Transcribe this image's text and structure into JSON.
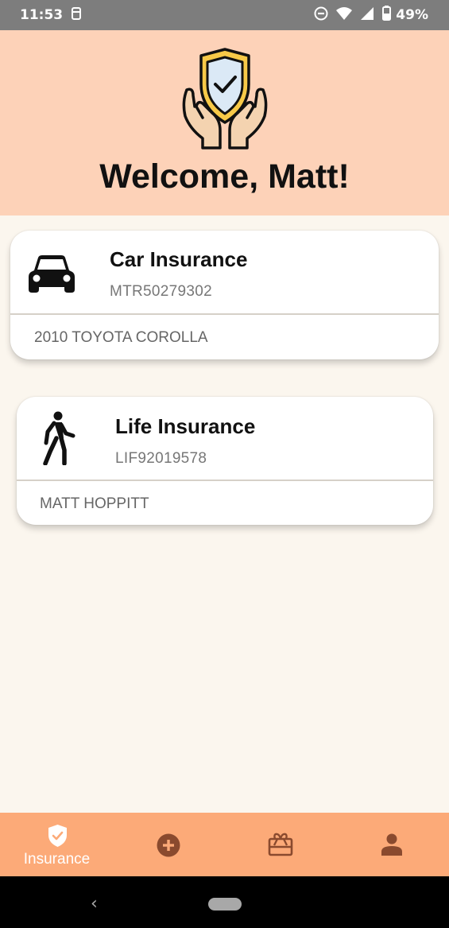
{
  "status_bar": {
    "time": "11:53",
    "battery": "49%",
    "icons": [
      "screenshot-icon",
      "dnd-icon",
      "wifi-icon",
      "signal-icon",
      "battery-icon"
    ]
  },
  "header": {
    "welcome_text": "Welcome, Matt!",
    "logo_icon": "shield-hands-icon"
  },
  "policies": [
    {
      "icon": "car-icon",
      "title": "Car Insurance",
      "policy_number": "MTR50279302",
      "subtitle": "2010 TOYOTA COROLLA"
    },
    {
      "icon": "walking-person-icon",
      "title": "Life Insurance",
      "policy_number": "LIF92019578",
      "subtitle": "MATT HOPPITT"
    }
  ],
  "bottom_nav": {
    "items": [
      {
        "icon": "shield-check-icon",
        "label": "Insurance",
        "active": true
      },
      {
        "icon": "plus-circle-icon",
        "label": "",
        "active": false
      },
      {
        "icon": "gift-card-icon",
        "label": "",
        "active": false
      },
      {
        "icon": "person-icon",
        "label": "",
        "active": false
      }
    ]
  },
  "colors": {
    "header_bg": "#fdd2b8",
    "nav_bg": "#fcaa78",
    "page_bg": "#fbf6ee",
    "nav_icon_inactive": "#8a4a2e"
  }
}
